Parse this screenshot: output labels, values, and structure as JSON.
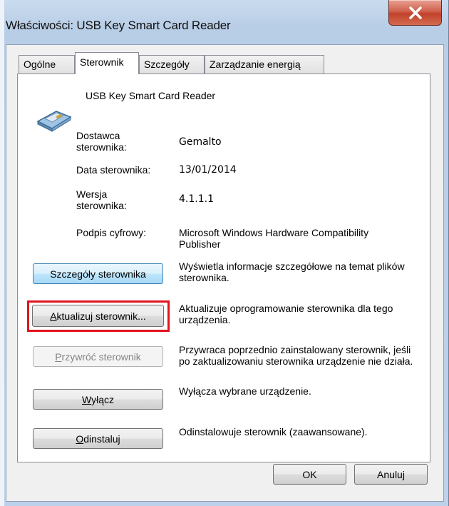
{
  "window": {
    "title": "Właściwości: USB Key Smart Card Reader",
    "close_icon": "close-icon"
  },
  "tabs": [
    {
      "label": "Ogólne"
    },
    {
      "label": "Sterownik"
    },
    {
      "label": "Szczegóły"
    },
    {
      "label": "Zarządzanie energią"
    }
  ],
  "device": {
    "name": "USB Key Smart Card Reader",
    "icon": "smart-card-reader-icon"
  },
  "driver_info": {
    "provider_label": "Dostawca\nsterownika:",
    "provider_value": "Gemalto",
    "date_label": "Data sterownika:",
    "date_value": "13/01/2014",
    "version_label": "Wersja\nsterownika:",
    "version_value": "4.1.1.1",
    "signer_label": "Podpis cyfrowy:",
    "signer_value": "Microsoft Windows Hardware Compatibility Publisher"
  },
  "actions": {
    "details_label": "Szczegóły sterownika",
    "details_desc": "Wyświetla informacje szczegółowe na temat plików sterownika.",
    "update_label_pre": "",
    "update_label_u": "A",
    "update_label_post": "ktualizuj sterownik...",
    "update_desc": "Aktualizuje oprogramowanie sterownika dla tego urządzenia.",
    "rollback_label_u": "P",
    "rollback_label_post": "rzywróć sterownik",
    "rollback_desc": "Przywraca poprzednio zainstalowany sterownik, jeśli po zaktualizowaniu sterownika urządzenie nie działa.",
    "disable_label_u": "W",
    "disable_label_post": "yłącz",
    "disable_desc": "Wyłącza wybrane urządzenie.",
    "uninstall_label_u": "O",
    "uninstall_label_post": "dinstaluj",
    "uninstall_desc": "Odinstalowuje sterownik (zaawansowane)."
  },
  "footer": {
    "ok_label": "OK",
    "cancel_label": "Anuluj"
  },
  "colors": {
    "highlight": "#e0141e",
    "close_button": "#c7432b"
  }
}
